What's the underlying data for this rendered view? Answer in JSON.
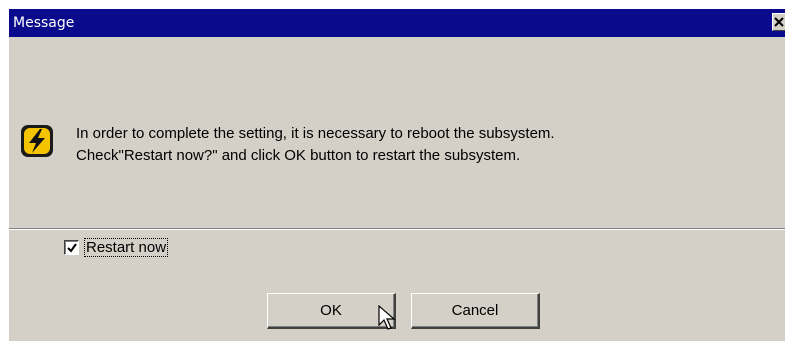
{
  "window": {
    "title": "Message",
    "close_icon": "close-x-icon"
  },
  "message": {
    "icon": "warning-lightning-icon",
    "line1": "In order to complete the setting, it is necessary to reboot the subsystem.",
    "line2": "Check\"Restart now?\" and click OK button to restart the subsystem."
  },
  "restart_checkbox": {
    "label": "Restart now",
    "checked": true
  },
  "buttons": {
    "ok_label": "OK",
    "cancel_label": "Cancel"
  },
  "colors": {
    "titlebar": "#0a0a8c",
    "dialog_bg": "#d4d0c8",
    "icon_yellow": "#f5c400"
  }
}
